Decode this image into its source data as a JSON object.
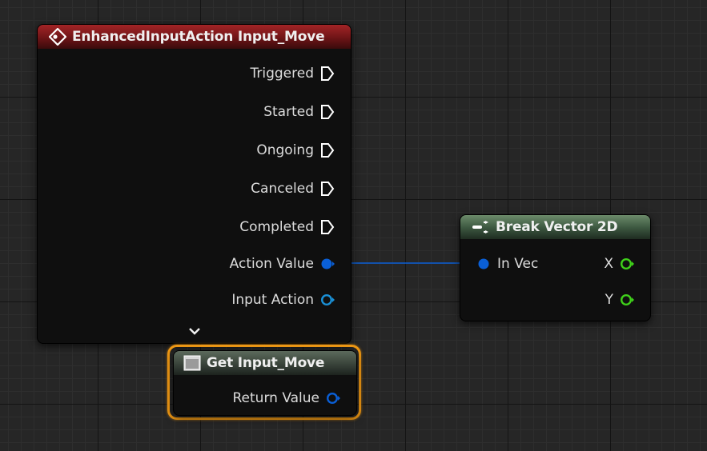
{
  "colors": {
    "exec_pin": "#ffffff",
    "struct_pin": "#0a5fd6",
    "object_pin": "#1a90d6",
    "float_pin": "#3fcf1a",
    "wire": "#0a5fd6",
    "event_header": "#8b1c1e",
    "pure_header": "#4e6b50",
    "selection": "#f29a14"
  },
  "event_node": {
    "title": "EnhancedInputAction Input_Move",
    "icon": "event-diamond-icon",
    "outputs": {
      "triggered": "Triggered",
      "started": "Started",
      "ongoing": "Ongoing",
      "canceled": "Canceled",
      "completed": "Completed",
      "action_value": "Action Value",
      "input_action": "Input Action"
    },
    "expand_glyph": "⌄"
  },
  "break_node": {
    "title": "Break Vector 2D",
    "icon": "break-struct-icon",
    "input": "In Vec",
    "output_x": "X",
    "output_y": "Y"
  },
  "getter_node": {
    "title": "Get Input_Move",
    "icon": "variable-getter-icon",
    "output": "Return Value",
    "selected": true
  }
}
